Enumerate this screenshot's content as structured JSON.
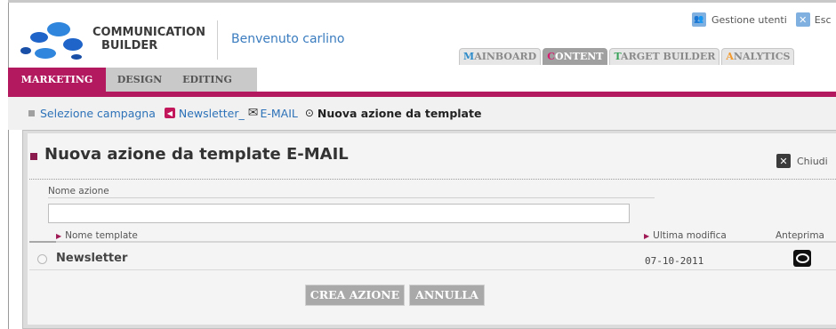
{
  "header": {
    "brand_line1": "COMMUNICATION",
    "brand_line2": "BUILDER",
    "welcome": "Benvenuto carlino",
    "user_links": {
      "users": "Gestione utenti",
      "logout": "Esc"
    }
  },
  "main_tabs": [
    {
      "first": "M",
      "rest": "AINBOARD"
    },
    {
      "first": "C",
      "rest": "ONTENT"
    },
    {
      "first": "T",
      "rest": "ARGET BUILDER"
    },
    {
      "first": "A",
      "rest": "NALYTICS"
    }
  ],
  "sub_tabs": [
    "MARKETING",
    "DESIGN",
    "EDITING"
  ],
  "breadcrumb": {
    "step1": "Selezione campagna",
    "step2": "Newsletter_",
    "step3": "E-MAIL",
    "step4": "Nuova azione da template"
  },
  "panel": {
    "title": "Nuova azione da template E-MAIL",
    "close_label": "Chiudi",
    "name_label": "Nome azione",
    "name_value": "",
    "columns": {
      "template": "Nome template",
      "modified": "Ultima modifica",
      "preview": "Anteprima"
    },
    "rows": [
      {
        "name": "Newsletter",
        "date": "07-10-2011"
      }
    ],
    "create_button": "CREA AZIONE",
    "cancel_button": "ANNULLA"
  },
  "colors": {
    "accent": "#b3195f",
    "link": "#2d72b8",
    "tab_active": "#a0a0a0"
  }
}
